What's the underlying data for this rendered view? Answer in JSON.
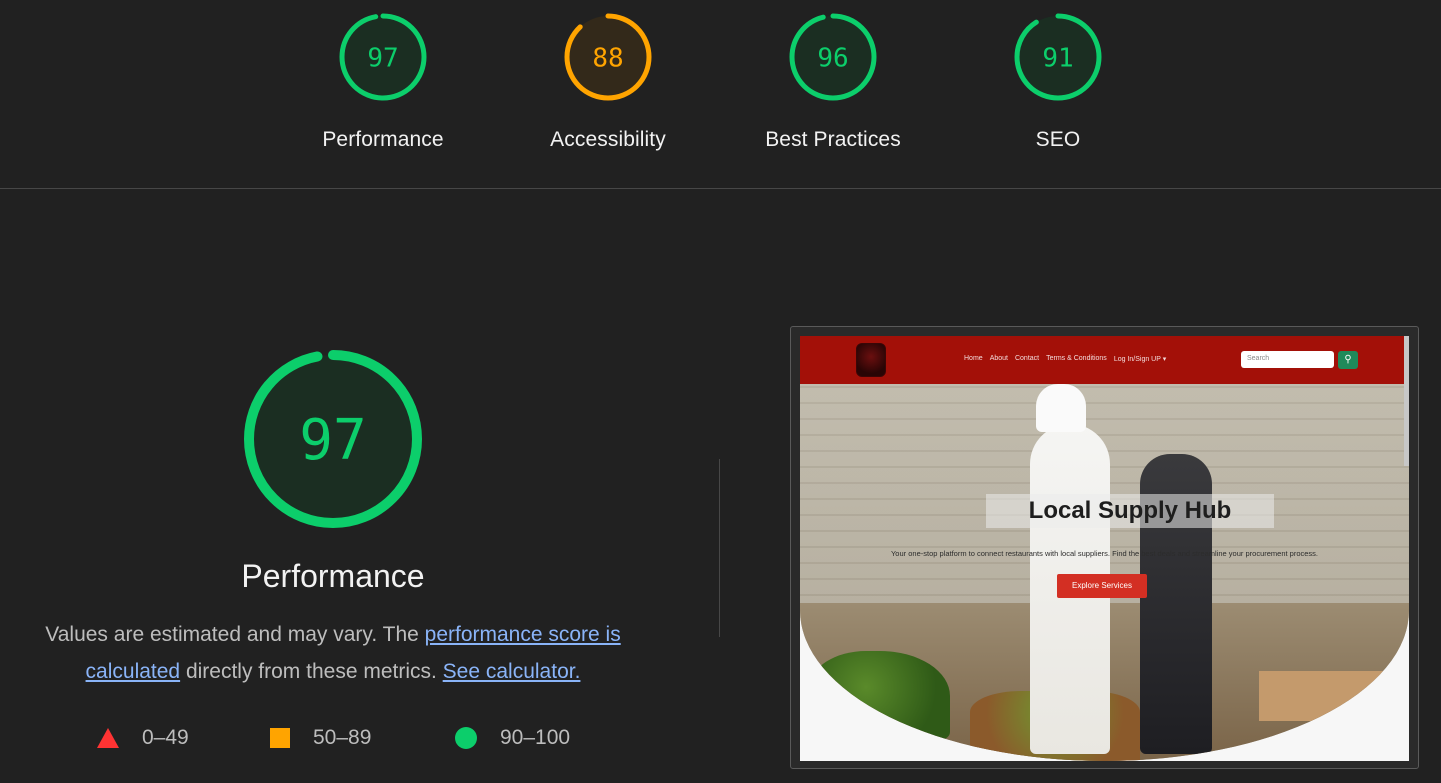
{
  "gauges": [
    {
      "label": "Performance",
      "score": "97",
      "value": 97,
      "color": "#0cce6b",
      "bg": "#1b2e22"
    },
    {
      "label": "Accessibility",
      "score": "88",
      "value": 88,
      "color": "#ffa400",
      "bg": "#33291a"
    },
    {
      "label": "Best Practices",
      "score": "96",
      "value": 96,
      "color": "#0cce6b",
      "bg": "#1b2e22"
    },
    {
      "label": "SEO",
      "score": "91",
      "value": 91,
      "color": "#0cce6b",
      "bg": "#1b2e22"
    }
  ],
  "main": {
    "score": "97",
    "value": 97,
    "title": "Performance",
    "desc_prefix": "Values are estimated and may vary. The ",
    "desc_link1": "performance score is calculated",
    "desc_middle": " directly from these metrics. ",
    "desc_link2": "See calculator."
  },
  "legend": [
    {
      "range": "0–49",
      "shape": "triangle",
      "color": "#ff3333"
    },
    {
      "range": "50–89",
      "shape": "square",
      "color": "#ffa400"
    },
    {
      "range": "90–100",
      "shape": "circle",
      "color": "#0cce6b"
    }
  ],
  "screenshot": {
    "nav_links": [
      "Home",
      "About",
      "Contact",
      "Terms & Conditions",
      "Log In/Sign UP ▾"
    ],
    "search_placeholder": "Search",
    "search_icon": "search-icon",
    "hero_title": "Local Supply Hub",
    "hero_subtitle": "Your one-stop platform to connect restaurants with local suppliers. Find the best deals and streamline your procurement process.",
    "hero_button": "Explore Services"
  }
}
